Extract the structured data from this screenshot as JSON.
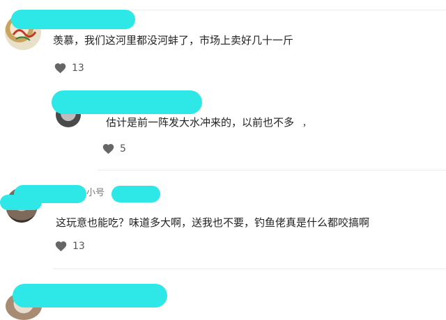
{
  "comments": [
    {
      "text": "羡慕，我们这河里都没河蚌了，市场上卖好几十一斤",
      "likes": "13",
      "replies": [
        {
          "text": "估计是前一阵发大水冲来的，以前也不多",
          "suffix": "，",
          "likes": "5"
        }
      ]
    },
    {
      "name_fragment": "小号",
      "text": "这玩意也能吃？味道多大啊，送我也不要，钓鱼佬真是什么都咬搞啊",
      "likes": "13"
    }
  ],
  "icons": {
    "like": "heart-icon"
  },
  "colors": {
    "name_redaction": "#2ee8e8",
    "text": "#222222",
    "meta": "#555555",
    "divider": "#ececec"
  }
}
